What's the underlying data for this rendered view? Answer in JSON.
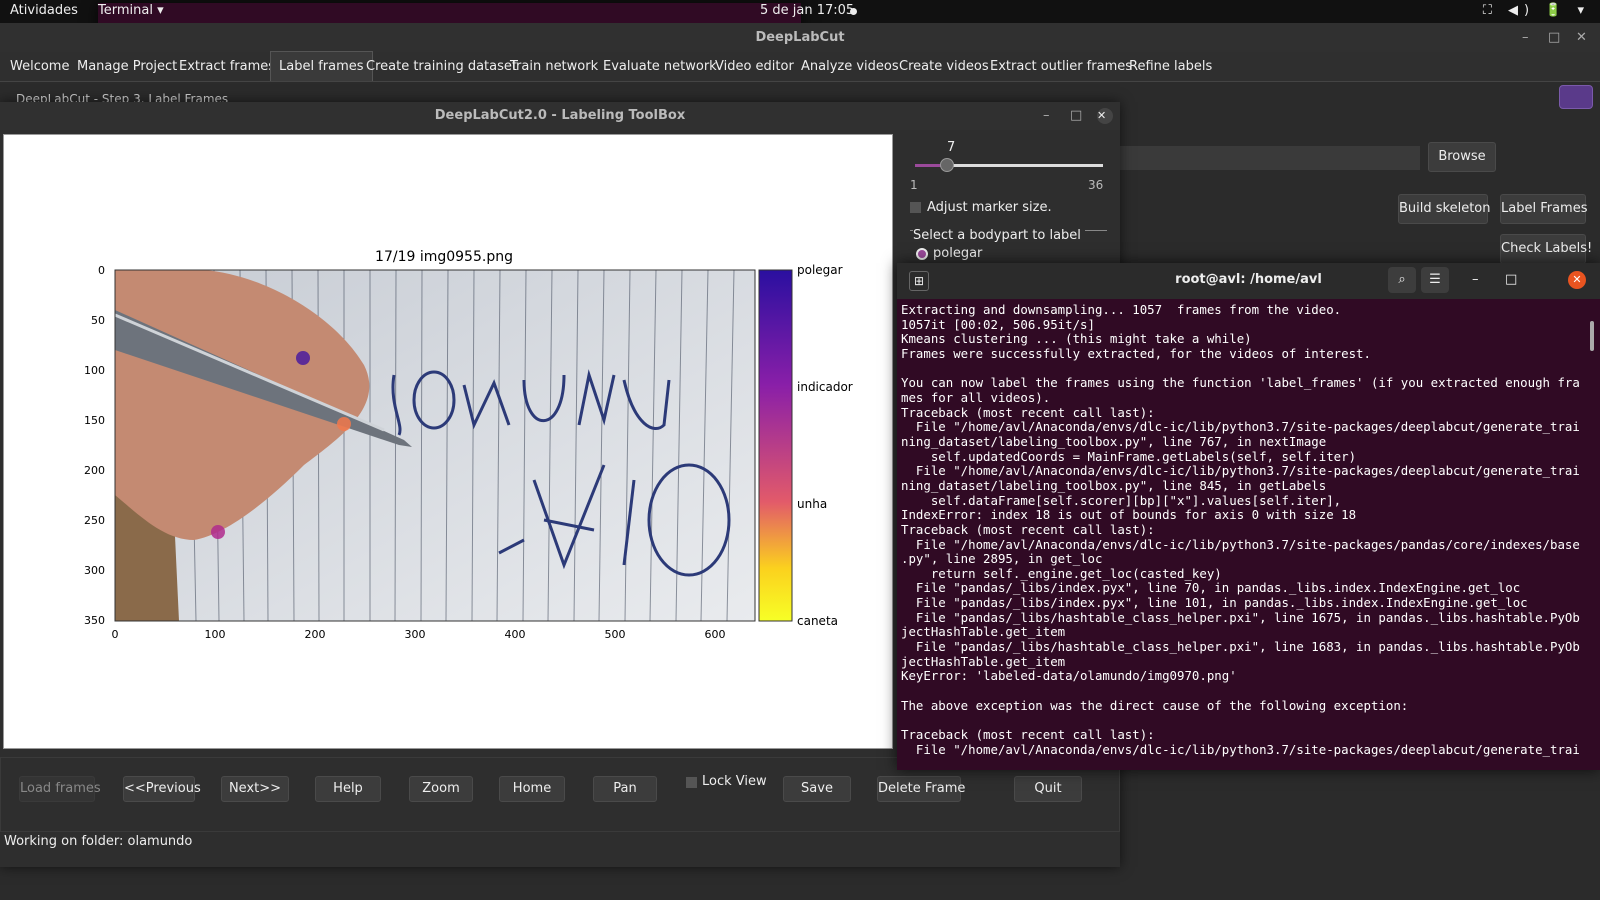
{
  "topbar": {
    "activities": "Atividades",
    "app": "Terminal ▾",
    "clock": "5 de jan  17:05",
    "tray": "⛶ ◀) 🔋 ▾"
  },
  "dlc": {
    "title": "DeepLabCut",
    "tabs": [
      "Welcome",
      "Manage Project",
      "Extract frames",
      "Label frames",
      "Create training dataset",
      "Train network",
      "Evaluate network",
      "Video editor",
      "Analyze videos",
      "Create videos",
      "Extract outlier frames",
      "Refine labels"
    ],
    "hidden_heading": "DeepLabCut - Step 3. Label Frames",
    "browse": "Browse",
    "build_skeleton": "Build skeleton",
    "label_frames": "Label Frames",
    "check_labels": "Check Labels!"
  },
  "toolbox": {
    "title": "DeepLabCut2.0 - Labeling ToolBox",
    "marker_value": "7",
    "slider": {
      "min": "1",
      "max": "36",
      "value": 7
    },
    "adjust_marker": "Adjust marker size.",
    "select_bodypart": "Select a bodypart to label",
    "bodypart_selected": "polegar",
    "buttons": {
      "load": "Load frames",
      "previous": "<<Previous",
      "next": "Next>>",
      "help": "Help",
      "zoom": "Zoom",
      "home": "Home",
      "pan": "Pan",
      "lock_view": "Lock View",
      "save": "Save",
      "delete": "Delete Frame",
      "quit": "Quit"
    },
    "status": "Working on folder: olamundo"
  },
  "plot": {
    "title": "17/19 img0955.png",
    "x_ticks": [
      "0",
      "100",
      "200",
      "300",
      "400",
      "500",
      "600"
    ],
    "y_ticks": [
      "0",
      "50",
      "100",
      "150",
      "200",
      "250",
      "300",
      "350"
    ],
    "colorbar_labels": [
      "polegar",
      "indicador",
      "unha",
      "caneta"
    ],
    "handwriting_lines": [
      "OLA-",
      "MUNDO!"
    ],
    "markers": [
      {
        "part": "indicador",
        "x": 188,
        "y": 88,
        "color": "#4b1b9e"
      },
      {
        "part": "unha",
        "x": 229,
        "y": 154,
        "color": "#f2784b"
      },
      {
        "part": "polegar",
        "x": 103,
        "y": 262,
        "color": "#b02a8d"
      }
    ],
    "colors": {
      "c0": "#2a0fa0",
      "c1": "#8a1fa8",
      "c2": "#e25a6a",
      "c3": "#fbd11e",
      "c4": "#f7ff26"
    }
  },
  "terminal": {
    "title": "root@avl: /home/avl",
    "lines": [
      "Extracting and downsampling... 1057  frames from the video.",
      "1057it [00:02, 506.95it/s]",
      "Kmeans clustering ... (this might take a while)",
      "Frames were successfully extracted, for the videos of interest.",
      "",
      "You can now label the frames using the function 'label_frames' (if you extracted enough fra",
      "mes for all videos).",
      "Traceback (most recent call last):",
      "  File \"/home/avl/Anaconda/envs/dlc-ic/lib/python3.7/site-packages/deeplabcut/generate_trai",
      "ning_dataset/labeling_toolbox.py\", line 767, in nextImage",
      "    self.updatedCoords = MainFrame.getLabels(self, self.iter)",
      "  File \"/home/avl/Anaconda/envs/dlc-ic/lib/python3.7/site-packages/deeplabcut/generate_trai",
      "ning_dataset/labeling_toolbox.py\", line 845, in getLabels",
      "    self.dataFrame[self.scorer][bp][\"x\"].values[self.iter],",
      "IndexError: index 18 is out of bounds for axis 0 with size 18",
      "Traceback (most recent call last):",
      "  File \"/home/avl/Anaconda/envs/dlc-ic/lib/python3.7/site-packages/pandas/core/indexes/base",
      ".py\", line 2895, in get_loc",
      "    return self._engine.get_loc(casted_key)",
      "  File \"pandas/_libs/index.pyx\", line 70, in pandas._libs.index.IndexEngine.get_loc",
      "  File \"pandas/_libs/index.pyx\", line 101, in pandas._libs.index.IndexEngine.get_loc",
      "  File \"pandas/_libs/hashtable_class_helper.pxi\", line 1675, in pandas._libs.hashtable.PyOb",
      "jectHashTable.get_item",
      "  File \"pandas/_libs/hashtable_class_helper.pxi\", line 1683, in pandas._libs.hashtable.PyOb",
      "jectHashTable.get_item",
      "KeyError: 'labeled-data/olamundo/img0970.png'",
      "",
      "The above exception was the direct cause of the following exception:",
      "",
      "Traceback (most recent call last):",
      "  File \"/home/avl/Anaconda/envs/dlc-ic/lib/python3.7/site-packages/deeplabcut/generate_trai"
    ]
  }
}
